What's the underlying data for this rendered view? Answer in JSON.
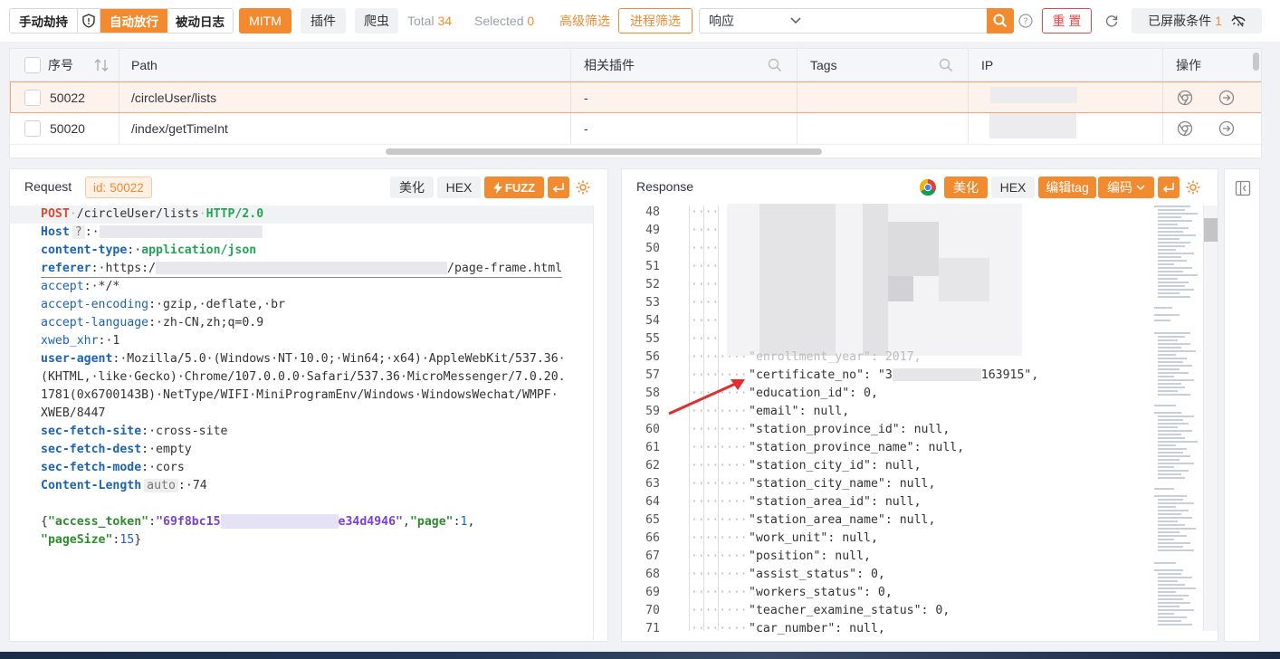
{
  "toolbar": {
    "mode_manual": "手动劫持",
    "mode_auto": "自动放行",
    "mode_passive": "被动日志",
    "mitm": "MITM",
    "plugins": "插件",
    "crawler": "爬虫",
    "total_label": "Total",
    "total_value": "34",
    "selected_label": "Selected",
    "selected_value": "0",
    "advanced_filter": "高级筛选",
    "process_filter": "进程筛选",
    "search_scope": "响应",
    "search_placeholder": "",
    "reset": "重 置",
    "blocked_label": "已屏蔽条件",
    "blocked_count": "1"
  },
  "table": {
    "columns": [
      "序号",
      "Path",
      "相关插件",
      "Tags",
      "IP",
      "操作"
    ],
    "rows": [
      {
        "id": "50022",
        "path": "/circleUser/lists",
        "plugin": "-",
        "tags": "",
        "selected": true
      },
      {
        "id": "50020",
        "path": "/index/getTimeInt",
        "plugin": "-",
        "tags": "",
        "selected": false
      }
    ]
  },
  "request": {
    "title": "Request",
    "id_label": "id:",
    "id_value": "50022",
    "beautify": "美化",
    "hex": "HEX",
    "fuzz": "FUZZ",
    "lines": {
      "method": "POST",
      "path": "/circleUser/lists",
      "proto": "HTTP/2.0",
      "host_key": "Host",
      "host_badge": "?",
      "ct_key": "content-type",
      "ct_val": "application/json",
      "referer_key": "referer",
      "referer_val_a": "https:/",
      "referer_val_b": "/page-frame.html",
      "accept_key": "accept",
      "accept_val": "*/*",
      "ae_key": "accept-encoding",
      "ae_val": "gzip,·deflate,·br",
      "al_key": "accept-language",
      "al_val": "zh-CN,zh;q=0.9",
      "xweb_key": "xweb_xhr",
      "xweb_val": "1",
      "ua_key": "user-agent",
      "ua_1": "Mozilla/5.0·(Windows·NT·10.0;·Win64;·x64)·AppleWebKit/537.36·",
      "ua_2": "(KHTML,·like·Gecko)·Chrome/107.0.0.0·Safari/537.36·MicroMessenger/7.0.20.",
      "ua_3": "1781(0x6700143B)·NetType/WIFI·MiniProgramEnv/Windows·WindowsWechat/WMPF·",
      "ua_4": "XWEB/8447",
      "sfs_key": "sec-fetch-site",
      "sfs_val": "cross-site",
      "sfd_key": "sec-fetch-dest",
      "sfd_val": "empty",
      "sfm_key": "sec-fetch-mode",
      "sfm_val": "cors",
      "cl_key": "Content-Length",
      "cl_badge": "auto",
      "cl_val": "74",
      "body_key1": "\"access_token\"",
      "body_val1a": "\"69f8bc15",
      "body_val1b": "e34d4946\"",
      "body_key2": "\"page\"",
      "body_val2": "1",
      "body_key3": "\"pageSize\"",
      "body_val3": "15"
    }
  },
  "response": {
    "title": "Response",
    "beautify": "美化",
    "hex": "HEX",
    "edit_tag": "编辑tag",
    "encoding": "编码",
    "line_numbers": [
      "48",
      "49",
      "50",
      "51",
      "52",
      "53",
      "54",
      "55",
      "56",
      "57",
      "58",
      "59",
      "60",
      "61",
      "62",
      "63",
      "64",
      "65",
      "66",
      "67",
      "68",
      "69",
      "70",
      "71"
    ],
    "json_lines": [
      {
        "n": "57",
        "text": "\"certificate_no\": \"3",
        "tail": "163915\","
      },
      {
        "n": "58",
        "text": "\"education_id\": 0,"
      },
      {
        "n": "59",
        "text": "\"email\": null,"
      },
      {
        "n": "60",
        "text": "\"station_province_id\": null,"
      },
      {
        "n": "61",
        "text": "\"station_province_name\": null,"
      },
      {
        "n": "62",
        "text": "\"station_city_id\": null,"
      },
      {
        "n": "63",
        "text": "\"station_city_name\": null,"
      },
      {
        "n": "64",
        "text": "\"station_area_id\": null,"
      },
      {
        "n": "65",
        "text": "\"station_area_name\": null,"
      },
      {
        "n": "66",
        "text": "\"work_unit\": null,"
      },
      {
        "n": "67",
        "text": "\"position\": null,"
      },
      {
        "n": "68",
        "text": "\"assist_status\": 0,"
      },
      {
        "n": "69",
        "text": "\"workers_status\": 0,"
      },
      {
        "n": "70",
        "text": "\"teacher_examine_status\": 0,"
      },
      {
        "n": "71",
        "text": "\"car_number\": null,"
      }
    ]
  },
  "colors": {
    "accent": "#f28b30",
    "danger": "#e04848"
  }
}
